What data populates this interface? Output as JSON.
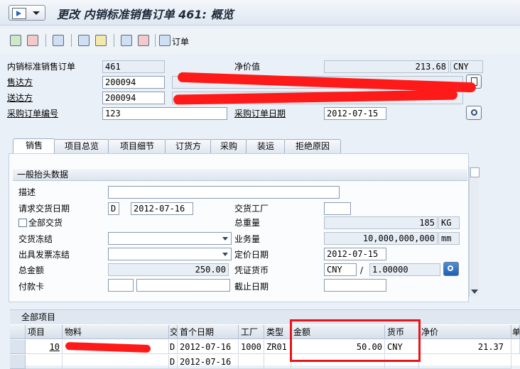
{
  "window": {
    "title": "更改 内销标准销售订单 461: 概览"
  },
  "toolbar": {
    "order_label": "订单"
  },
  "header": {
    "order_type_label": "内销标准销售订单",
    "order_no": "461",
    "net_value_label": "净价值",
    "net_value": "213.68",
    "net_currency": "CNY",
    "sold_to_label": "售达方",
    "sold_to": "200094",
    "ship_to_label": "送达方",
    "ship_to": "200094",
    "po_no_label": "采购订单编号",
    "po_no": "123",
    "po_date_label": "采购订单日期",
    "po_date": "2012-07-15"
  },
  "tabs": [
    {
      "label": "销售"
    },
    {
      "label": "项目总览"
    },
    {
      "label": "项目细节"
    },
    {
      "label": "订货方"
    },
    {
      "label": "采购"
    },
    {
      "label": "装运"
    },
    {
      "label": "拒绝原因"
    }
  ],
  "general": {
    "group_title": "一般抬头数据",
    "desc_label": "描述",
    "req_date_label": "请求交货日期",
    "req_date_fmt": "D",
    "req_date": "2012-07-16",
    "plant_label": "交货工厂",
    "full_delivery_label": "全部交货",
    "total_weight_label": "总重量",
    "total_weight": "185",
    "weight_unit": "KG",
    "delivery_block_label": "交货冻结",
    "volume_label": "业务量",
    "volume": "10,000,000,000",
    "volume_unit": "mm",
    "billing_block_label": "出具发票冻结",
    "pricing_date_label": "定价日期",
    "pricing_date": "2012-07-15",
    "total_amount_label": "总金额",
    "total_amount": "250.00",
    "doc_currency_label": "凭证货币",
    "doc_currency": "CNY",
    "exchange_rate": "1.00000",
    "payment_card_label": "付款卡",
    "expiry_label": "截止日期"
  },
  "items": {
    "title": "全部项目",
    "columns": [
      "项目",
      "物料",
      "交",
      "首个日期",
      "工厂",
      "类型",
      "金额",
      "货币",
      "净价",
      "单"
    ],
    "rows": [
      {
        "item": "10",
        "fmt": "D",
        "first_date": "2012-07-16",
        "plant": "1000",
        "type": "ZR01",
        "amount": "50.00",
        "currency": "CNY",
        "net_price": "21.37"
      },
      {
        "item": "",
        "fmt": "D",
        "first_date": "2012-07-16",
        "plant": "",
        "type": "",
        "amount": "",
        "currency": "",
        "net_price": ""
      }
    ]
  }
}
